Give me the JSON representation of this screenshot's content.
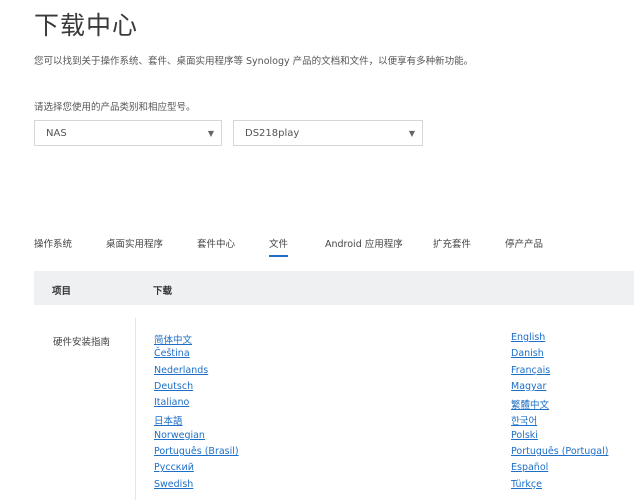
{
  "page": {
    "title": "下载中心",
    "description": "您可以找到关于操作系统、套件、桌面实用程序等 Synology 产品的文档和文件，以便享有多种新功能。",
    "prompt": "请选择您使用的产品类别和相应型号。"
  },
  "selects": {
    "category": "NAS",
    "model": "DS218play"
  },
  "tabs": [
    "操作系统",
    "桌面实用程序",
    "套件中心",
    "文件",
    "Android 应用程序",
    "扩充套件",
    "停产产品"
  ],
  "active_tab": "文件",
  "table": {
    "headers": [
      "项目",
      "下载"
    ],
    "row_label": "硬件安装指南",
    "col1": [
      "简体中文",
      "Čeština",
      "Nederlands",
      "Deutsch",
      "Italiano",
      "日本語",
      "Norwegian",
      "Português (Brasil)",
      "Русский",
      "Swedish"
    ],
    "col2": [
      "English",
      "Danish",
      "Français",
      "Magyar",
      "繁體中文",
      "한국어",
      "Polski",
      "Português (Portugal)",
      "Español",
      "Türkçe"
    ]
  },
  "icons": {
    "dropdown": "chevron-down-icon"
  },
  "colors": {
    "link": "#1e6fc8",
    "header_bg": "#eff0f2"
  }
}
